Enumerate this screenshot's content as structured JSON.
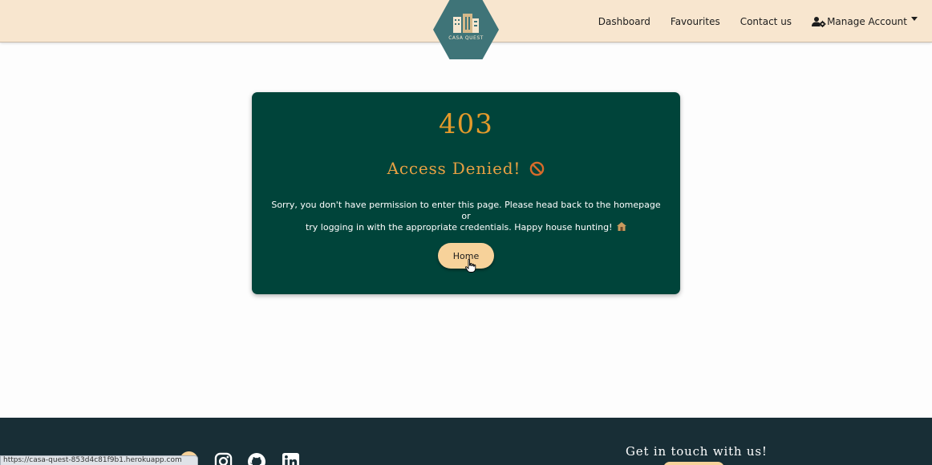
{
  "brand": {
    "logo_text": "CASA QUEST"
  },
  "nav": {
    "links": [
      "Dashboard",
      "Favourites",
      "Contact us"
    ],
    "account_label": "Manage Account"
  },
  "error": {
    "code": "403",
    "title": "Access Denied!",
    "message_line1": "Sorry, you don't have permission to enter this page. Please head back to the homepage or",
    "message_line2": "try logging in with the appropriate credentials. Happy house hunting!",
    "home_label": "Home"
  },
  "footer": {
    "heading": "Get in touch with us!",
    "social_icons": [
      "facebook-icon",
      "instagram-icon",
      "github-icon",
      "linkedin-icon"
    ]
  },
  "status_bar": {
    "url": "https://casa-quest-853d4c81f9b1.herokuapp.com"
  },
  "colors": {
    "navbar": "#f8e6cf",
    "card": "#00443a",
    "accent": "#e49a2b",
    "button": "#f7d29a",
    "footer": "#182e36",
    "logo": "#3f7478"
  }
}
